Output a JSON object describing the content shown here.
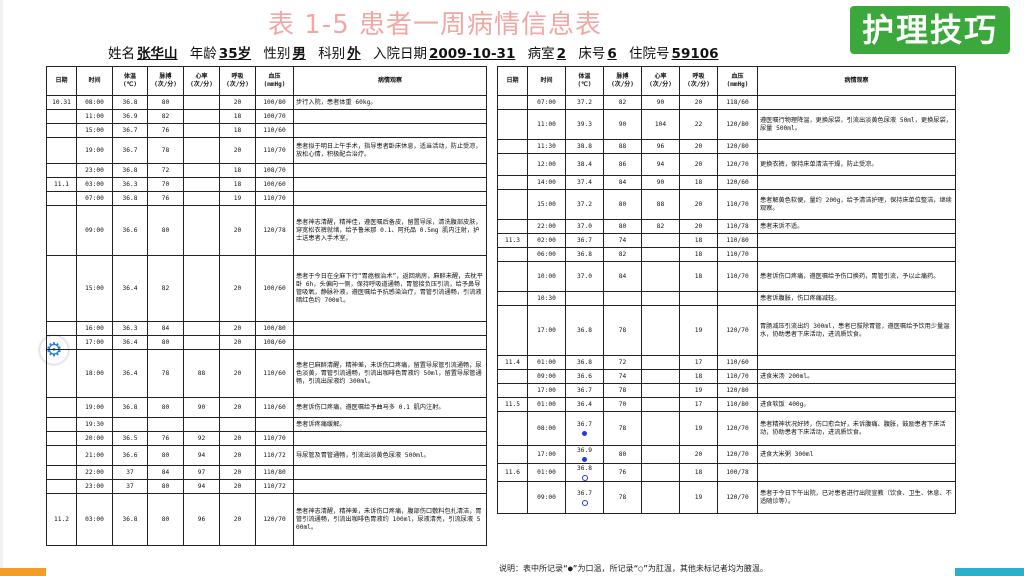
{
  "slide": {
    "title": "表 1-5  患者一周病情信息表",
    "badge": "护理技巧"
  },
  "patient": {
    "name_label": "姓名",
    "name": "张华山",
    "age_label": "年龄",
    "age": "35岁",
    "sex_label": "性别",
    "sex": "男",
    "dept_label": "科别",
    "dept": "外",
    "admit_label": "入院日期",
    "admit": "2009-10-31",
    "ward_label": "病室",
    "ward": "2",
    "bed_label": "床号",
    "bed": "6",
    "id_label": "住院号",
    "id": "59106"
  },
  "headers": [
    "日期",
    "时间",
    "体温\n(℃)",
    "脉搏\n(次/分)",
    "心率\n(次/分)",
    "呼吸\n(次/分)",
    "血压\n(mmHg)",
    "病情观察"
  ],
  "left_rows": [
    {
      "date": "10.31",
      "time": "08:00",
      "temp": "36.8",
      "pulse": "80",
      "hr": "",
      "resp": "20",
      "bp": "100/80",
      "note": "步行入院，患者体重 60kg。",
      "h": 14
    },
    {
      "date": "",
      "time": "11:00",
      "temp": "36.9",
      "pulse": "82",
      "hr": "",
      "resp": "18",
      "bp": "100/70",
      "note": "",
      "h": 14
    },
    {
      "date": "",
      "time": "15:00",
      "temp": "36.7",
      "pulse": "76",
      "hr": "",
      "resp": "18",
      "bp": "110/60",
      "note": "",
      "h": 14
    },
    {
      "date": "",
      "time": "19:00",
      "temp": "36.7",
      "pulse": "78",
      "hr": "",
      "resp": "20",
      "bp": "110/70",
      "note": "患者拟于明日上午手术，指导患者卧床休息，适当活动，防止受凉，放松心情，积极配合治疗。",
      "h": 26
    },
    {
      "date": "",
      "time": "23:00",
      "temp": "36.8",
      "pulse": "72",
      "hr": "",
      "resp": "18",
      "bp": "108/70",
      "note": "",
      "h": 14
    },
    {
      "date": "11.1",
      "time": "03:00",
      "temp": "36.3",
      "pulse": "70",
      "hr": "",
      "resp": "18",
      "bp": "100/60",
      "note": "",
      "h": 14
    },
    {
      "date": "",
      "time": "07:00",
      "temp": "36.8",
      "pulse": "76",
      "hr": "",
      "resp": "19",
      "bp": "110/70",
      "note": "",
      "h": 14
    },
    {
      "date": "",
      "time": "09:00",
      "temp": "36.6",
      "pulse": "80",
      "hr": "",
      "resp": "20",
      "bp": "120/78",
      "note": "患者神志清醒，精神佳，遵医嘱后备皮，留置导尿，清洗腹部皮肤，穿宽松衣裤就绪，给予鲁米那 0.1、阿托品 0.5mg 肌内注射，护士送患者入手术室。",
      "h": 50
    },
    {
      "date": "",
      "time": "15:00",
      "temp": "36.4",
      "pulse": "82",
      "hr": "",
      "resp": "20",
      "bp": "100/60",
      "note": "患者于今日在全麻下行“胃癌根治术”，返回病房，麻醉未醒，去枕平卧 6h，头偏向一侧，保持呼吸道通畅，胃管接负压引流，给予鼻导管吸氧，静脉补液，遵医嘱给予抗感染治疗，胃管引流通畅，引流液暗红色约 700ml。",
      "h": 66
    },
    {
      "date": "",
      "time": "16:00",
      "temp": "36.3",
      "pulse": "84",
      "hr": "",
      "resp": "20",
      "bp": "100/80",
      "note": "",
      "h": 14
    },
    {
      "date": "",
      "time": "17:00",
      "temp": "36.4",
      "pulse": "80",
      "hr": "",
      "resp": "20",
      "bp": "108/60",
      "note": "",
      "h": 14
    },
    {
      "date": "",
      "time": "18:00",
      "temp": "36.4",
      "pulse": "78",
      "hr": "88",
      "resp": "20",
      "bp": "110/60",
      "note": "患者已麻醉清醒，精神差，未诉伤口疼痛，留置导尿管引流通畅，尿色淡黄，胃管引流通畅，引流出咖啡色胃液约 50ml，留置导尿管通畅，引流出尿液约 300ml。",
      "h": 48
    },
    {
      "date": "",
      "time": "19:00",
      "temp": "36.8",
      "pulse": "80",
      "hr": "90",
      "resp": "20",
      "bp": "110/60",
      "note": "患者诉伤口疼痛，遵医嘱给予曲马多 0.1 肌内注射。",
      "h": 20
    },
    {
      "date": "",
      "time": "19:30",
      "temp": "",
      "pulse": "",
      "hr": "",
      "resp": "",
      "bp": "",
      "note": "患者诉疼痛缓解。",
      "h": 14
    },
    {
      "date": "",
      "time": "20:00",
      "temp": "36.5",
      "pulse": "76",
      "hr": "92",
      "resp": "20",
      "bp": "110/70",
      "note": "",
      "h": 14
    },
    {
      "date": "",
      "time": "21:00",
      "temp": "36.6",
      "pulse": "80",
      "hr": "94",
      "resp": "20",
      "bp": "110/72",
      "note": "导尿管及胃管通畅，引流出淡黄色尿液 500ml。",
      "h": 20
    },
    {
      "date": "",
      "time": "22:00",
      "temp": "37",
      "pulse": "84",
      "hr": "97",
      "resp": "20",
      "bp": "110/80",
      "note": "",
      "h": 14
    },
    {
      "date": "",
      "time": "23:00",
      "temp": "37",
      "pulse": "80",
      "hr": "94",
      "resp": "20",
      "bp": "110/72",
      "note": "",
      "h": 14
    },
    {
      "date": "11.2",
      "time": "03:00",
      "temp": "36.8",
      "pulse": "80",
      "hr": "96",
      "resp": "20",
      "bp": "120/70",
      "note": "患者神志清醒，精神差，未诉伤口疼痛，腹部伤口敷料包扎清洁，胃管引流通畅，引流出咖啡色胃液约 100ml，尿液清亮，引流尿液 500ml。",
      "h": 52
    }
  ],
  "right_rows": [
    {
      "date": "",
      "time": "07:00",
      "temp": "37.2",
      "pulse": "82",
      "hr": "90",
      "resp": "20",
      "bp": "118/60",
      "note": "",
      "h": 14
    },
    {
      "date": "",
      "time": "11:00",
      "temp": "39.3",
      "pulse": "90",
      "hr": "104",
      "resp": "22",
      "bp": "120/80",
      "note": "遵医嘱行物理降温，更换尿袋，引流出淡黄色尿液 50ml，更换尿袋，尿量 500ml。",
      "h": 30
    },
    {
      "date": "",
      "time": "11:30",
      "temp": "38.8",
      "pulse": "88",
      "hr": "96",
      "resp": "20",
      "bp": "120/80",
      "note": "",
      "h": 14
    },
    {
      "date": "",
      "time": "12:00",
      "temp": "38.4",
      "pulse": "86",
      "hr": "94",
      "resp": "20",
      "bp": "120/70",
      "note": "更换衣裤，保持床单清洁干燥，防止受凉。",
      "h": 22
    },
    {
      "date": "",
      "time": "14:00",
      "temp": "37.4",
      "pulse": "84",
      "hr": "90",
      "resp": "18",
      "bp": "120/60",
      "note": "",
      "h": 14
    },
    {
      "date": "",
      "time": "15:00",
      "temp": "37.2",
      "pulse": "80",
      "hr": "88",
      "resp": "20",
      "bp": "110/70",
      "note": "患者解黄色软便，量约 200g，给予清洁护理，保持床单位整洁，继续观察。",
      "h": 30
    },
    {
      "date": "",
      "time": "22:00",
      "temp": "37.0",
      "pulse": "80",
      "hr": "82",
      "resp": "20",
      "bp": "110/78",
      "note": "患者未诉不适。",
      "h": 14
    },
    {
      "date": "11.3",
      "time": "02:00",
      "temp": "36.7",
      "pulse": "74",
      "hr": "",
      "resp": "18",
      "bp": "110/80",
      "note": "",
      "h": 14
    },
    {
      "date": "",
      "time": "06:00",
      "temp": "36.8",
      "pulse": "82",
      "hr": "",
      "resp": "18",
      "bp": "110/70",
      "note": "",
      "h": 14
    },
    {
      "date": "",
      "time": "10:00",
      "temp": "37.0",
      "pulse": "84",
      "hr": "",
      "resp": "18",
      "bp": "110/70",
      "note": "患者诉伤口疼痛，遵医嘱给予伤口换药，胃管引流，予以止痛药。",
      "h": 30
    },
    {
      "date": "",
      "time": "10:30",
      "temp": "",
      "pulse": "",
      "hr": "",
      "resp": "",
      "bp": "",
      "note": "患者诉腹胀，伤口疼痛减轻。",
      "h": 14
    },
    {
      "date": "",
      "time": "17:00",
      "temp": "36.8",
      "pulse": "78",
      "hr": "",
      "resp": "19",
      "bp": "120/70",
      "note": "胃肠减压引流出约 300ml，患者已拔除胃管，遵医嘱给予饮用少量温水，协助患者下床活动，进流质饮食。",
      "h": 50
    },
    {
      "date": "11.4",
      "time": "01:00",
      "temp": "36.8",
      "pulse": "72",
      "hr": "",
      "resp": "17",
      "bp": "110/60",
      "note": "",
      "h": 14
    },
    {
      "date": "",
      "time": "09:00",
      "temp": "36.6",
      "pulse": "74",
      "hr": "",
      "resp": "18",
      "bp": "110/70",
      "note": "进食米汤 200ml。",
      "h": 14
    },
    {
      "date": "",
      "time": "17:00",
      "temp": "36.7",
      "pulse": "78",
      "hr": "",
      "resp": "19",
      "bp": "120/80",
      "note": "",
      "h": 14
    },
    {
      "date": "11.5",
      "time": "01:00",
      "temp": "36.4",
      "pulse": "70",
      "hr": "",
      "resp": "17",
      "bp": "110/80",
      "note": "进食软饭 400g。",
      "h": 14
    },
    {
      "date": "",
      "time": "08:00",
      "temp": "36.7",
      "pulse": "78",
      "hr": "",
      "resp": "19",
      "bp": "120/70",
      "note": "患者精神状况好转，伤口愈合好，未诉腹痛、腹胀，鼓励患者下床活动，协助患者下床活动，进流质饮食。",
      "h": 34,
      "dot": "filled"
    },
    {
      "date": "",
      "time": "17:00",
      "temp": "36.9",
      "pulse": "80",
      "hr": "",
      "resp": "20",
      "bp": "120/70",
      "note": "进食大米粥 300ml",
      "h": 18,
      "dot": "filled"
    },
    {
      "date": "11.6",
      "time": "01:00",
      "temp": "36.8",
      "pulse": "76",
      "hr": "",
      "resp": "18",
      "bp": "100/78",
      "note": "",
      "h": 18,
      "dot": "hollow"
    },
    {
      "date": "",
      "time": "09:00",
      "temp": "36.7",
      "pulse": "78",
      "hr": "",
      "resp": "19",
      "bp": "120/70",
      "note": "患者于今日下午出院，已对患者进行出院宣教（饮食、卫生、休息、不适随诊等）。",
      "h": 32,
      "dot": "hollow"
    }
  ],
  "footnote": "说明：表中所记录“●”为口温，所记录“○”为肛温，其他未标记者均为腋温。",
  "icons": {
    "settings": "gear-icon"
  },
  "colors": {
    "title": "#f0a8a4",
    "badge_bg": "#3aa83a",
    "dot": "#1e3ed6",
    "bar_orange": "#f39c26",
    "bar_teal": "#2bb0c9"
  }
}
